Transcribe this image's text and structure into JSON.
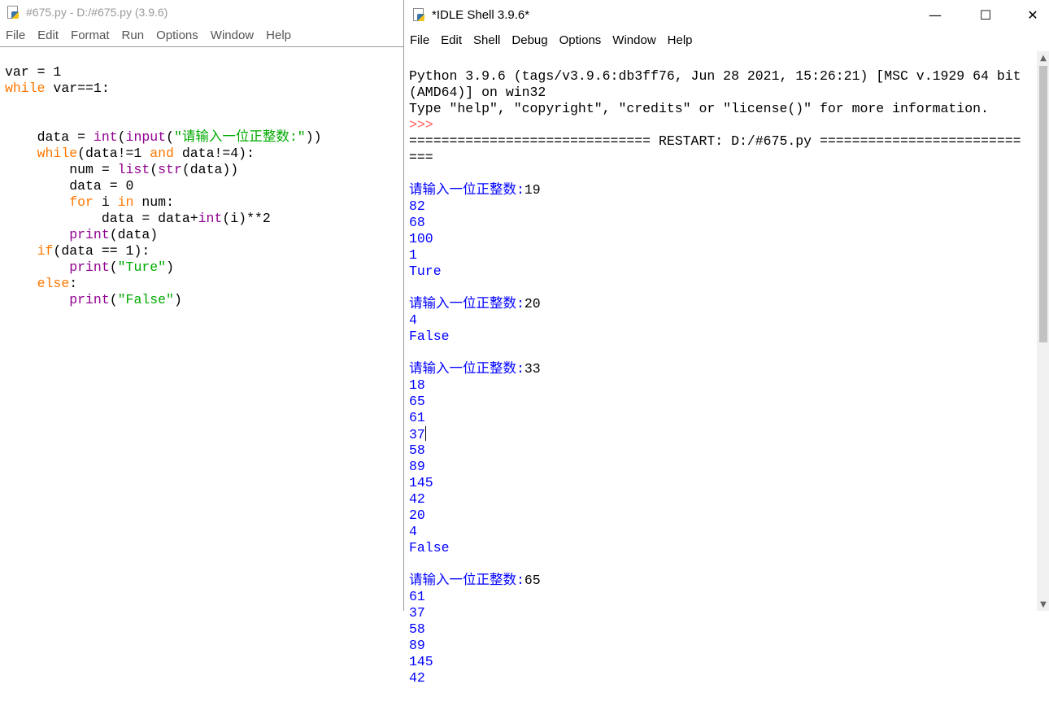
{
  "editor": {
    "title": "#675.py - D:/#675.py (3.9.6)",
    "menu": [
      "File",
      "Edit",
      "Format",
      "Run",
      "Options",
      "Window",
      "Help"
    ],
    "code": {
      "l1": "var = 1",
      "l2a": "while",
      "l2b": " var==1:",
      "l5a": "    data = ",
      "l5b": "int",
      "l5c": "(",
      "l5d": "input",
      "l5e": "(",
      "l5f": "\"请输入一位正整数:\"",
      "l5g": "))",
      "l6a": "    ",
      "l6b": "while",
      "l6c": "(data!=1 ",
      "l6d": "and",
      "l6e": " data!=4):",
      "l7a": "        num = ",
      "l7b": "list",
      "l7c": "(",
      "l7d": "str",
      "l7e": "(data))",
      "l8": "        data = 0",
      "l9a": "        ",
      "l9b": "for",
      "l9c": " i ",
      "l9d": "in",
      "l9e": " num:",
      "l10a": "            data = data+",
      "l10b": "int",
      "l10c": "(i)**2",
      "l11a": "        ",
      "l11b": "print",
      "l11c": "(data)",
      "l12a": "    ",
      "l12b": "if",
      "l12c": "(data == 1):",
      "l13a": "        ",
      "l13b": "print",
      "l13c": "(",
      "l13d": "\"Ture\"",
      "l13e": ")",
      "l14a": "    ",
      "l14b": "else",
      "l14c": ":",
      "l15a": "        ",
      "l15b": "print",
      "l15c": "(",
      "l15d": "\"False\"",
      "l15e": ")"
    }
  },
  "shell": {
    "title": "*IDLE Shell 3.9.6*",
    "menu": [
      "File",
      "Edit",
      "Shell",
      "Debug",
      "Options",
      "Window",
      "Help"
    ],
    "controls": {
      "minimize": "—",
      "maximize": "☐",
      "close": "✕"
    },
    "banner1": "Python 3.9.6 (tags/v3.9.6:db3ff76, Jun 28 2021, 15:26:21) [MSC v.1929 64 bit",
    "banner2": "(AMD64)] on win32",
    "banner3": "Type \"help\", \"copyright\", \"credits\" or \"license()\" for more information.",
    "prompt": ">>>",
    "restart1": "============================== RESTART: D:/#675.py =========================",
    "restart2": "===",
    "runs": [
      {
        "prompt": "请输入一位正整数:",
        "input": "19",
        "outputs": [
          "82",
          "68",
          "100",
          "1",
          "Ture"
        ]
      },
      {
        "prompt": "请输入一位正整数:",
        "input": "20",
        "outputs": [
          "4",
          "False"
        ]
      },
      {
        "prompt": "请输入一位正整数:",
        "input": "33",
        "outputs": [
          "18",
          "65",
          "61",
          "37",
          "58",
          "89",
          "145",
          "42",
          "20",
          "4",
          "False"
        ]
      },
      {
        "prompt": "请输入一位正整数:",
        "input": "65",
        "outputs": [
          "61",
          "37",
          "58",
          "89",
          "145",
          "42"
        ]
      }
    ]
  },
  "colors": {
    "keyword": "#ff7700",
    "builtin": "#900090",
    "string": "#00aa00",
    "stdout": "#0000ff",
    "prompt": "#ff5a5a"
  }
}
